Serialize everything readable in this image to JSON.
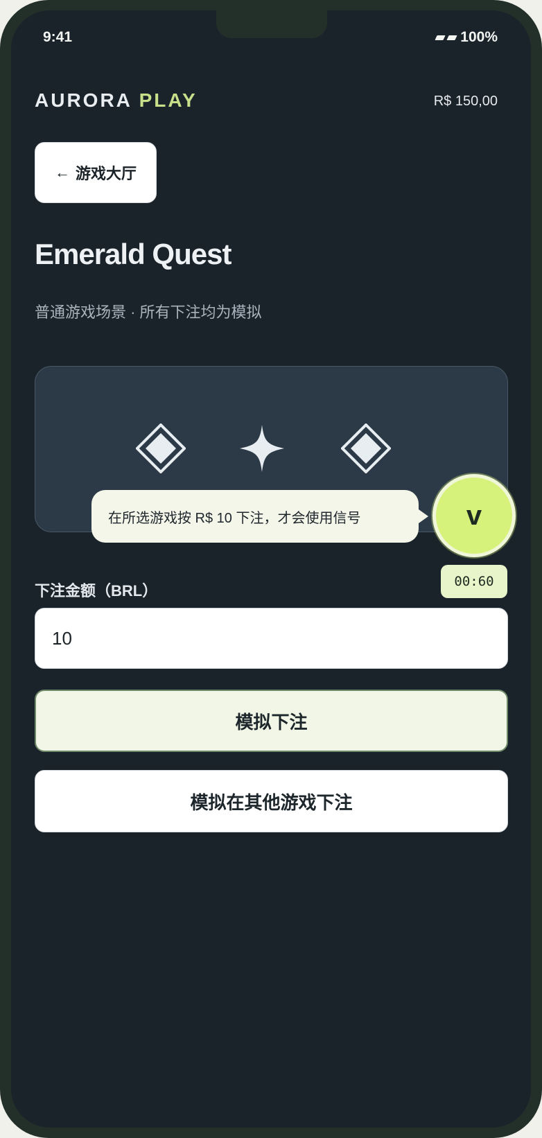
{
  "status_bar": {
    "time": "9:41",
    "battery": "100%",
    "signal_icon": "signal-icon"
  },
  "header": {
    "brand_main": "AURORA",
    "brand_accent": "PLAY",
    "balance": "R$ 150,00"
  },
  "nav": {
    "back_arrow": "←",
    "back_label": "游戏大厅"
  },
  "page": {
    "title": "Emerald Quest",
    "subtitle": "普通游戏场景 · 所有下注均为模拟"
  },
  "game_panel": {
    "symbols": [
      "diamond-icon",
      "sparkle-icon",
      "diamond-icon"
    ]
  },
  "signal": {
    "tooltip": "在所选游戏按 R$ 10 下注，才会使用信号",
    "avatar_letter": "v",
    "timer": "00:60"
  },
  "bet": {
    "label": "下注金额（BRL）",
    "value": "10"
  },
  "actions": {
    "primary_label": "模拟下注",
    "secondary_label": "模拟在其他游戏下注"
  },
  "colors": {
    "accent": "#c7e08a",
    "signal_green": "#d7f27a",
    "background": "#1a222a"
  }
}
